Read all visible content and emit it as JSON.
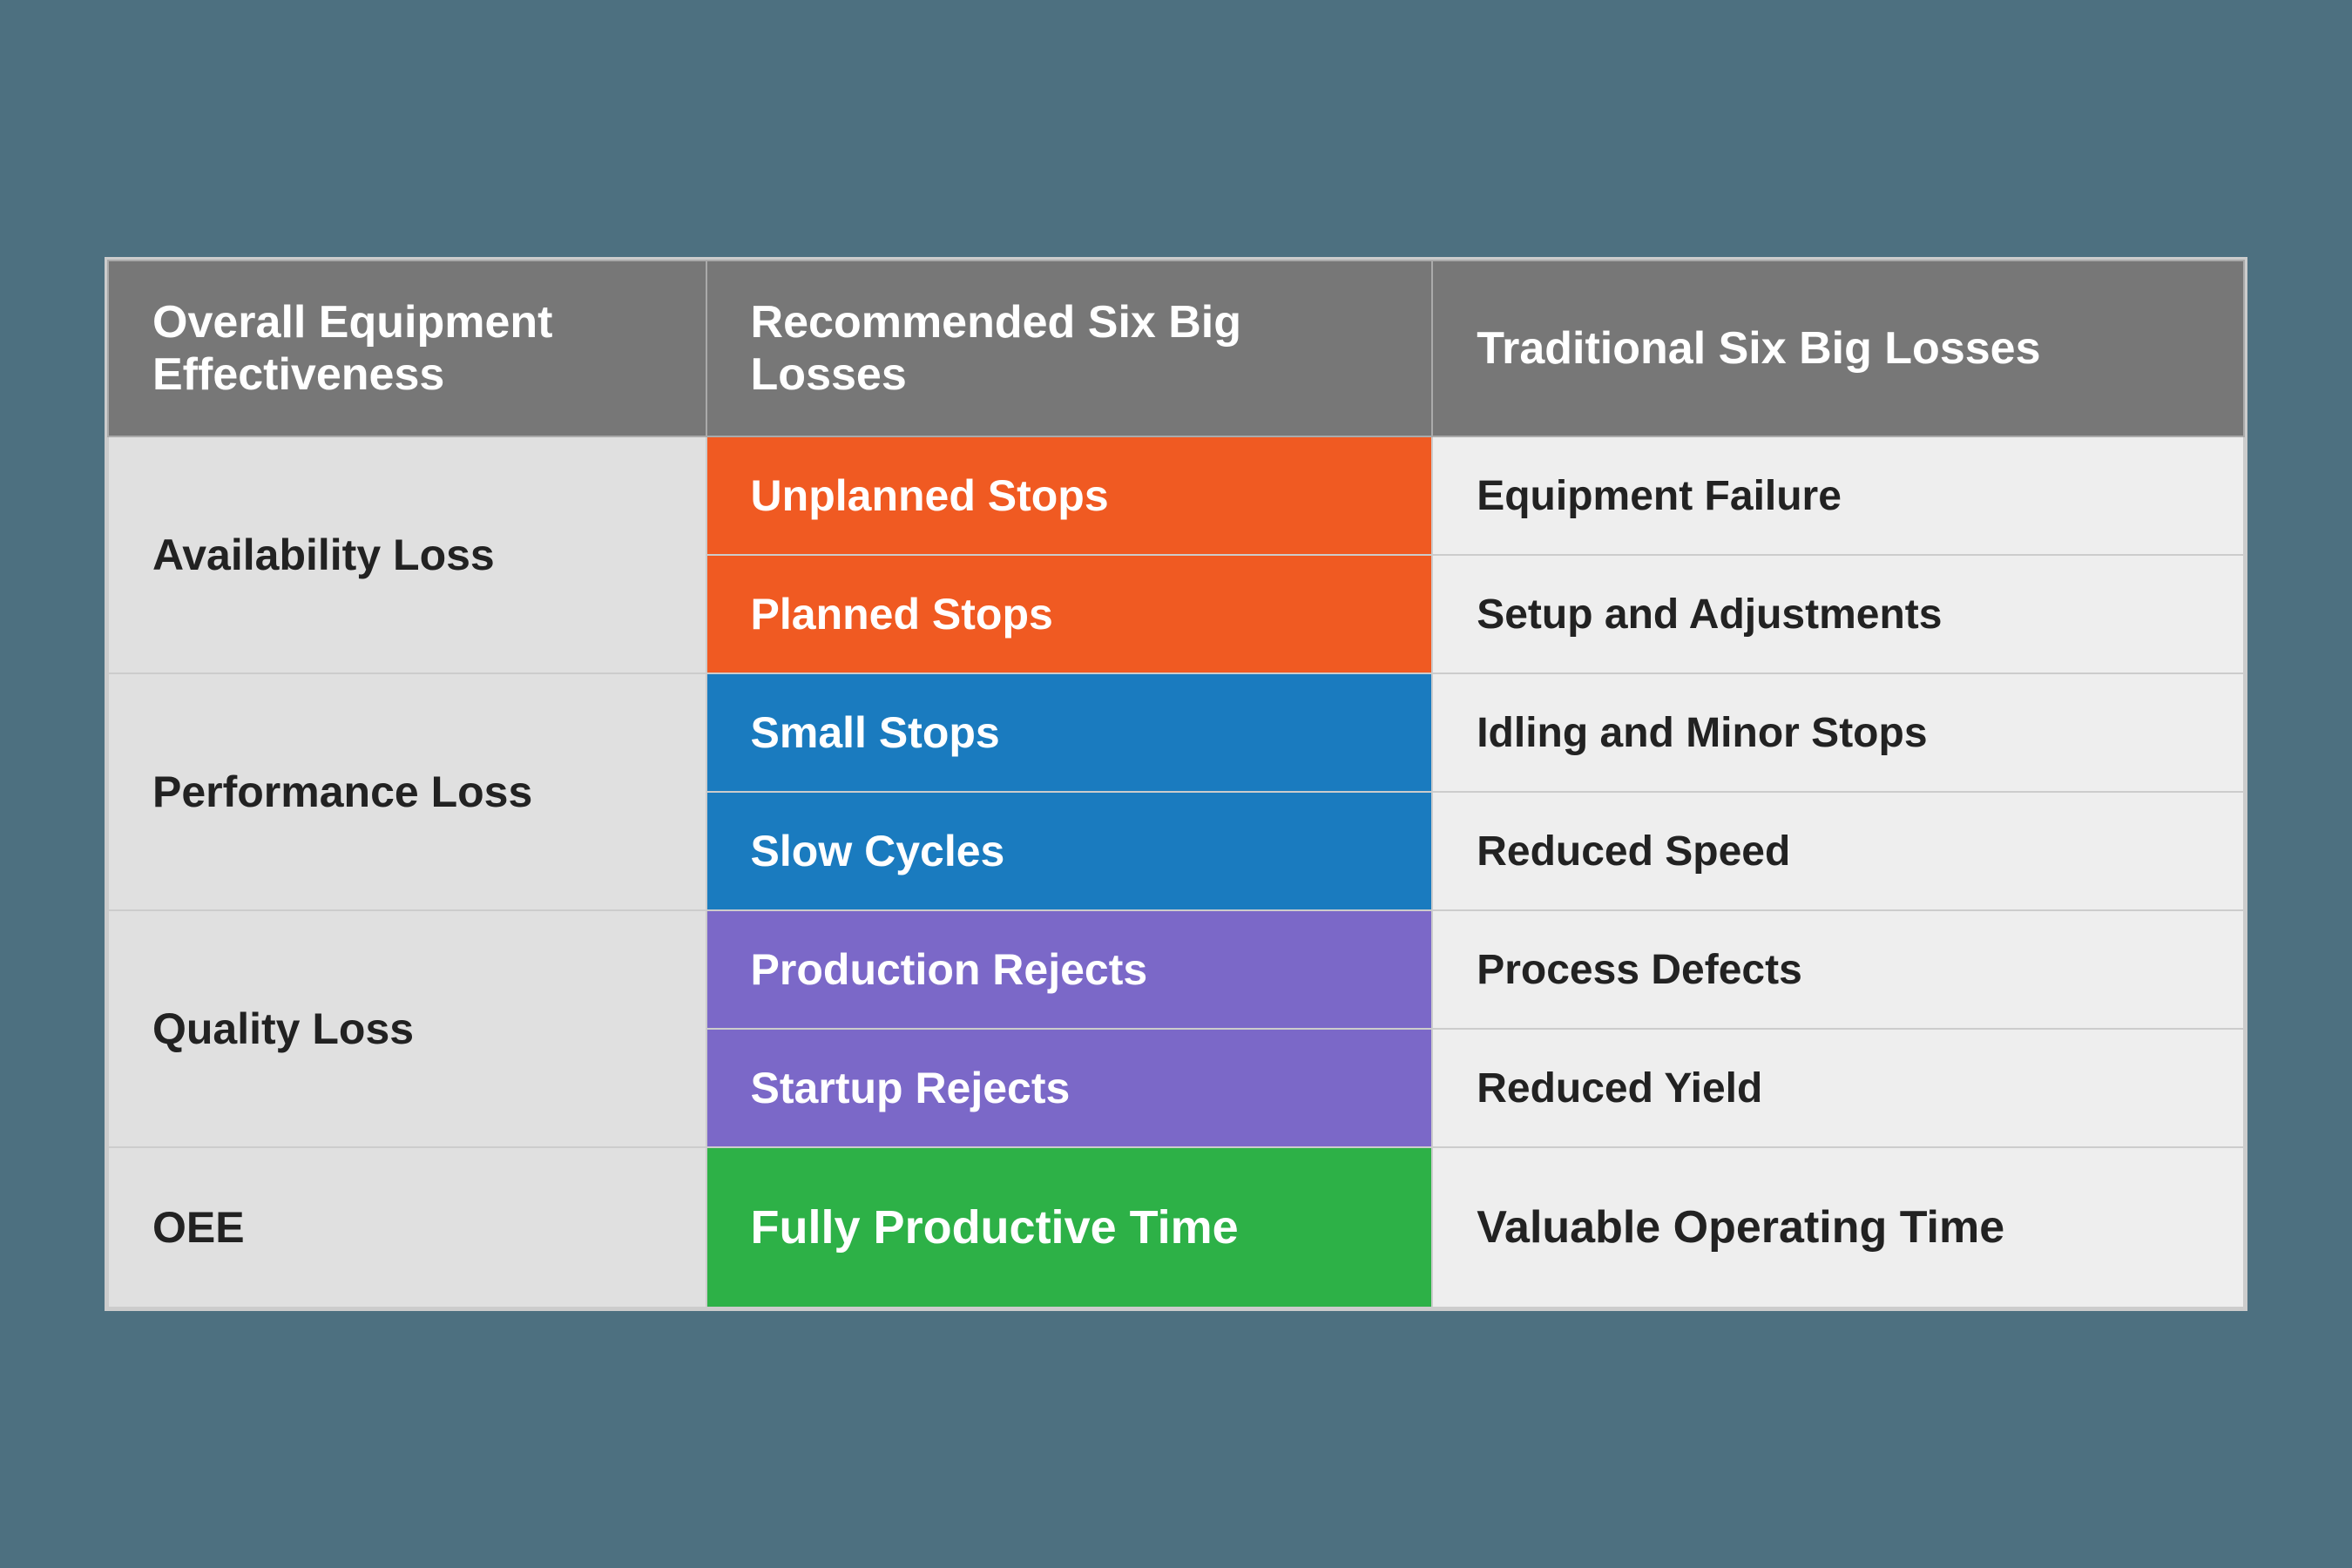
{
  "header": {
    "col1": "Overall Equipment Effectiveness",
    "col2": "Recommended Six Big Losses",
    "col3": "Traditional Six Big Losses"
  },
  "rows": {
    "availability": {
      "category": "Availability Loss",
      "items": [
        {
          "label": "Unplanned Stops",
          "color": "orange",
          "traditional": "Equipment Failure"
        },
        {
          "label": "Planned Stops",
          "color": "orange",
          "traditional": "Setup and Adjustments"
        }
      ]
    },
    "performance": {
      "category": "Performance Loss",
      "items": [
        {
          "label": "Small Stops",
          "color": "blue",
          "traditional": "Idling and Minor Stops"
        },
        {
          "label": "Slow Cycles",
          "color": "blue",
          "traditional": "Reduced Speed"
        }
      ]
    },
    "quality": {
      "category": "Quality Loss",
      "items": [
        {
          "label": "Production Rejects",
          "color": "purple",
          "traditional": "Process Defects"
        },
        {
          "label": "Startup Rejects",
          "color": "purple",
          "traditional": "Reduced Yield"
        }
      ]
    },
    "oee": {
      "category": "OEE",
      "label": "Fully Productive Time",
      "color": "green",
      "traditional": "Valuable Operating Time"
    }
  }
}
